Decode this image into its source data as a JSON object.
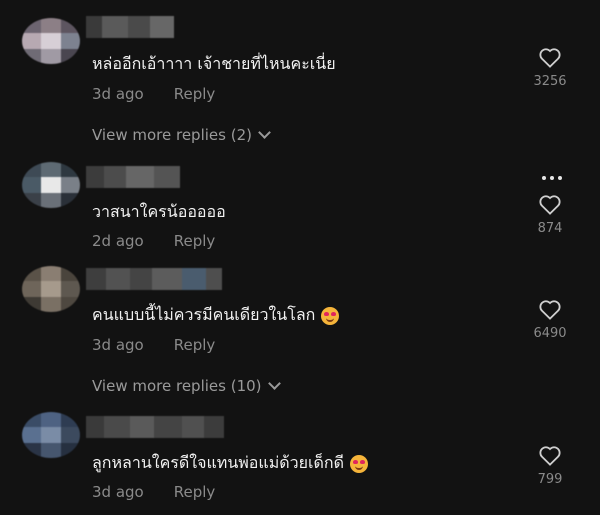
{
  "comments": [
    {
      "text": "หล่ออีกเอ้าาาา เจ้าชายที่ไหนคะเนี่ย",
      "time": "3d ago",
      "reply": "Reply",
      "likes": "3256",
      "view_more": "View more replies (2)",
      "has_emoji": false
    },
    {
      "text": "วาสนาใครน้อออออ",
      "time": "2d ago",
      "reply": "Reply",
      "likes": "874",
      "view_more": "",
      "has_emoji": false
    },
    {
      "text": "คนแบบนี้ไม่ควรมีคนเดียวในโลก",
      "time": "3d ago",
      "reply": "Reply",
      "likes": "6490",
      "view_more": "View more replies (10)",
      "has_emoji": true
    },
    {
      "text": "ลูกหลานใครดีใจแทนพ่อแม่ด้วยเด็กดี",
      "time": "3d ago",
      "reply": "Reply",
      "likes": "799",
      "view_more": "",
      "has_emoji": true
    }
  ],
  "icons": {
    "like": "heart-outline-icon",
    "more": "more-dots-icon",
    "expand": "chevron-down-icon",
    "emoji": "smiling-face-with-hearts-emoji"
  },
  "colors": {
    "background": "#121212",
    "text": "#f2f2f2",
    "muted": "#8a8a8a"
  }
}
